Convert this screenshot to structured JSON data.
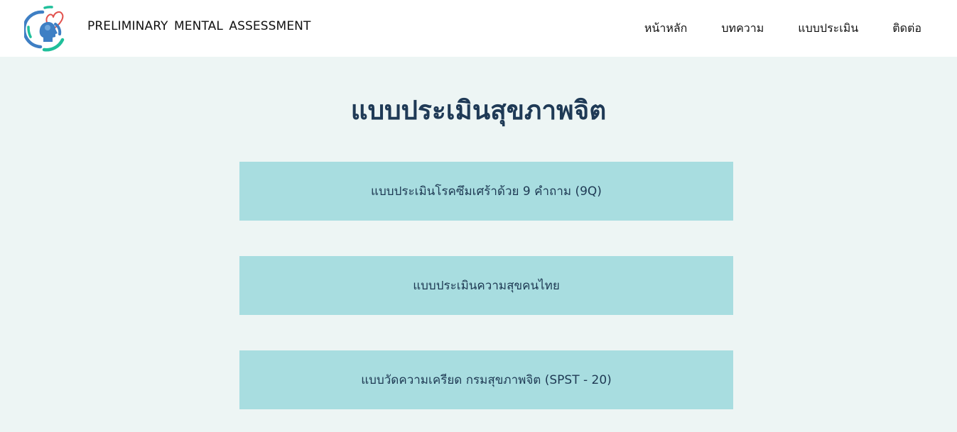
{
  "header": {
    "brand": "PRELIMINARY MENTAL ASSESSMENT",
    "nav": [
      {
        "label": "หน้าหลัก"
      },
      {
        "label": "บทความ"
      },
      {
        "label": "แบบประเมิน"
      },
      {
        "label": "ติดต่อ"
      }
    ]
  },
  "main": {
    "title": "แบบประเมินสุขภาพจิต",
    "assessments": [
      {
        "label": "แบบประเมินโรคซึมเศร้าด้วย 9 คำถาม (9Q)"
      },
      {
        "label": "แบบประเมินความสุขคนไทย"
      },
      {
        "label": "แบบวัดความเครียด กรมสุขภาพจิต (SPST - 20)"
      }
    ]
  },
  "colors": {
    "header_bg": "#ffffff",
    "page_bg": "#edf5f4",
    "card_bg": "#a8dde0",
    "title_color": "#1f3a56",
    "logo_blue": "#3e7fc4",
    "logo_teal": "#1fbf9a",
    "logo_red": "#e2534f"
  }
}
